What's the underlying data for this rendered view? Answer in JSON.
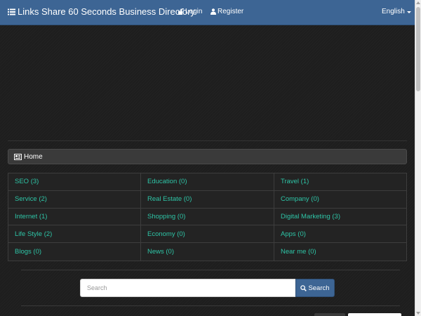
{
  "navbar": {
    "brand": "Links Share 60 Seconds Business Directory",
    "login": "Login",
    "register": "Register",
    "language": "English"
  },
  "breadcrumb": {
    "home": "Home"
  },
  "categories": [
    [
      "SEO (3)",
      "Education (0)",
      "Travel (1)"
    ],
    [
      "Service (2)",
      "Real Estate (0)",
      "Company (0)"
    ],
    [
      "Internet (1)",
      "Shopping (0)",
      "Digital Marketing (3)"
    ],
    [
      "Life Style (2)",
      "Economy (0)",
      "Apps (0)"
    ],
    [
      "Blogs (0)",
      "News (0)",
      "Near me (0)"
    ]
  ],
  "search": {
    "placeholder": "Search",
    "button": "Search"
  },
  "colors": {
    "navbar": "#3d6594",
    "link": "#2ec4a6",
    "background": "#1e1e1e"
  },
  "icons": {
    "brand": "list-icon",
    "login": "lock-icon",
    "register": "user-icon",
    "home": "newspaper-icon",
    "search": "search-icon"
  }
}
